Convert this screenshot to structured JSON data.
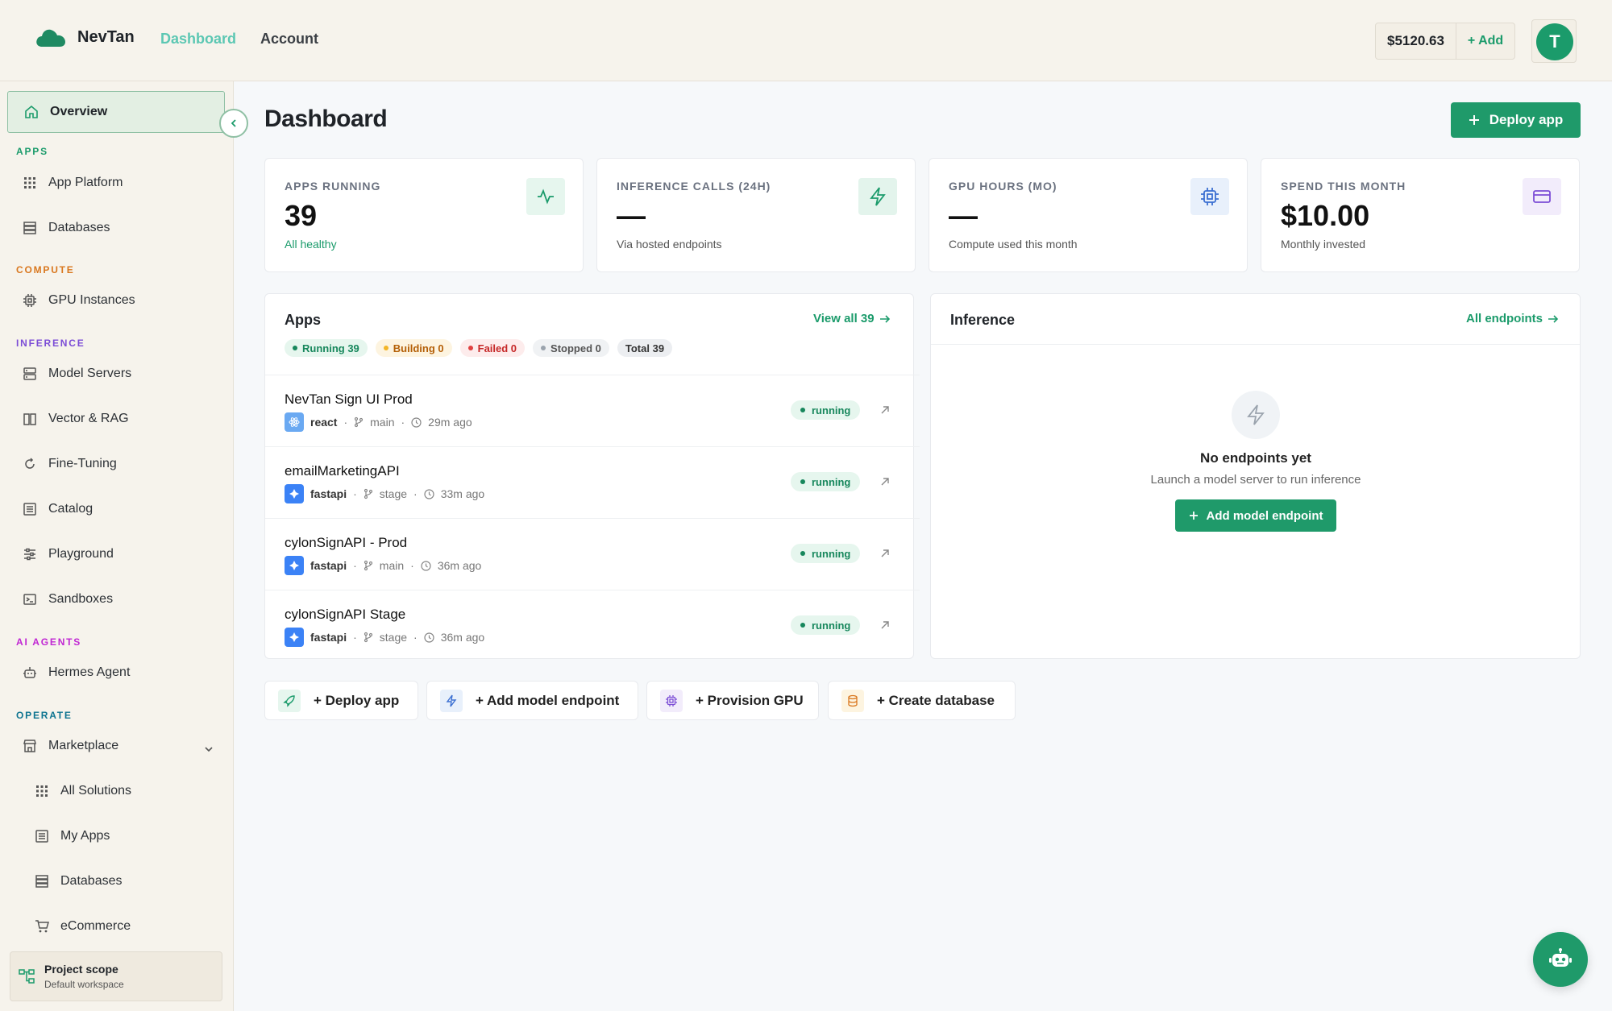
{
  "brand": {
    "name": "NevTan"
  },
  "topnav": {
    "dashboard": "Dashboard",
    "account": "Account"
  },
  "account": {
    "balance": "$5120.63",
    "add_funds": "+ Add",
    "avatar_initial": "T"
  },
  "sidebar": {
    "overview": "Overview",
    "sections": {
      "apps": "APPS",
      "compute": "COMPUTE",
      "inference": "INFERENCE",
      "ai_agents": "AI AGENTS",
      "operate": "OPERATE"
    },
    "section_colors": {
      "apps": "#1b9b6b",
      "compute": "#d9771e",
      "inference": "#7c4dd6",
      "ai_agents": "#c026d3",
      "operate": "#0e7490"
    },
    "items": {
      "app_platform": "App Platform",
      "databases": "Databases",
      "gpu_instances": "GPU Instances",
      "model_servers": "Model Servers",
      "vector_rag": "Vector & RAG",
      "fine_tuning": "Fine-Tuning",
      "catalog": "Catalog",
      "playground": "Playground",
      "sandboxes": "Sandboxes",
      "hermes_agent": "Hermes Agent",
      "marketplace": "Marketplace",
      "all_solutions": "All Solutions",
      "my_apps": "My Apps",
      "databases_sub": "Databases",
      "ecommerce": "eCommerce"
    },
    "project": {
      "title": "Project scope",
      "subtitle": "Default workspace"
    }
  },
  "main": {
    "title": "Dashboard",
    "deploy_button": "Deploy app",
    "stats": [
      {
        "label": "APPS RUNNING",
        "value": "39",
        "sub": "All healthy"
      },
      {
        "label": "INFERENCE CALLS (24H)",
        "value": "—",
        "sub": "Via hosted endpoints"
      },
      {
        "label": "GPU HOURS (MO)",
        "value": "—",
        "sub": "Compute used this month"
      },
      {
        "label": "SPEND THIS MONTH",
        "value": "$10.00",
        "sub": "Monthly invested"
      }
    ],
    "apps_panel": {
      "title": "Apps",
      "view_all": "View all 39",
      "chips": {
        "running": "Running 39",
        "building": "Building 0",
        "failed": "Failed 0",
        "stopped": "Stopped 0",
        "total": "Total 39"
      },
      "rows": [
        {
          "name": "NevTan Sign UI Prod",
          "framework": "react",
          "branch": "main",
          "age": "29m ago",
          "status": "running"
        },
        {
          "name": "emailMarketingAPI",
          "framework": "fastapi",
          "branch": "stage",
          "age": "33m ago",
          "status": "running"
        },
        {
          "name": "cylonSignAPI - Prod",
          "framework": "fastapi",
          "branch": "main",
          "age": "36m ago",
          "status": "running"
        },
        {
          "name": "cylonSignAPI Stage",
          "framework": "fastapi",
          "branch": "stage",
          "age": "36m ago",
          "status": "running"
        }
      ]
    },
    "inference_panel": {
      "title": "Inference",
      "all_endpoints": "All endpoints",
      "empty_title": "No endpoints yet",
      "empty_sub": "Launch a model server to run inference",
      "add_button": "Add model endpoint"
    },
    "quick_actions": {
      "deploy": "+ Deploy app",
      "model": "+ Add model endpoint",
      "gpu": "+ Provision GPU",
      "db": "+ Create database"
    }
  },
  "colors": {
    "accent": "#1f9a6a",
    "nav_active": "#5cc7b3",
    "running": "#17875c"
  }
}
